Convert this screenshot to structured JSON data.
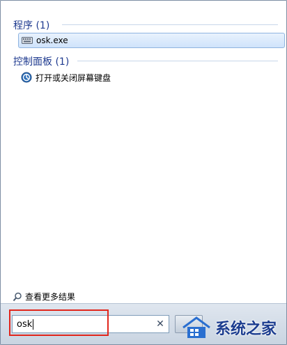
{
  "results": {
    "groups": [
      {
        "header": "程序 (1)",
        "items": [
          {
            "label": "osk.exe",
            "icon": "keyboard-icon"
          }
        ]
      },
      {
        "header": "控制面板 (1)",
        "items": [
          {
            "label": "打开或关闭屏幕键盘",
            "icon": "ease-of-access-icon"
          }
        ]
      }
    ],
    "more_results": "查看更多结果"
  },
  "search": {
    "value": "osk",
    "clear_icon": "close-icon"
  },
  "watermark": {
    "text": "系统之家"
  },
  "colors": {
    "group_header": "#1e3a8f",
    "highlight": "#e1261c",
    "selected_bg": "#cfe3fb"
  }
}
